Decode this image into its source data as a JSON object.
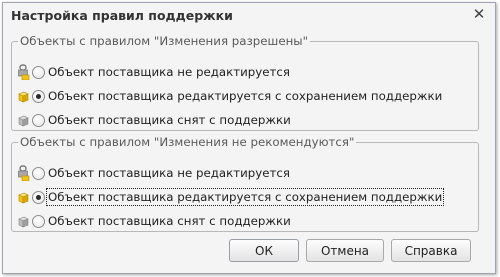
{
  "window": {
    "title": "Настройка правил поддержки",
    "close_symbol": "✕"
  },
  "group1": {
    "title": "Объекты с правилом \"Изменения разрешены\"",
    "options": [
      {
        "icon": "lock-icon",
        "label": "Объект поставщика не редактируется",
        "checked": false
      },
      {
        "icon": "cube-icon",
        "label": "Объект поставщика редактируется с сохранением поддержки",
        "checked": true
      },
      {
        "icon": "cube-gray-icon",
        "label": "Объект поставщика снят с поддержки",
        "checked": false
      }
    ]
  },
  "group2": {
    "title": "Объекты с правилом \"Изменения не рекомендуются\"",
    "options": [
      {
        "icon": "lock-icon",
        "label": "Объект поставщика не редактируется",
        "checked": false
      },
      {
        "icon": "cube-icon",
        "label": "Объект поставщика редактируется с сохранением поддержки",
        "checked": true
      },
      {
        "icon": "cube-gray-icon",
        "label": "Объект поставщика снят с поддержки",
        "checked": false
      }
    ]
  },
  "buttons": {
    "ok": "ОК",
    "cancel": "Отмена",
    "help": "Справка"
  },
  "colors": {
    "cube": "#f0c419",
    "lock": "#8a8a8a"
  }
}
